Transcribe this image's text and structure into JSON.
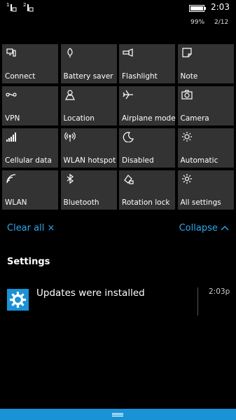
{
  "status_bar": {
    "sim1_index": "1",
    "sim2_index": "2",
    "time": "2:03",
    "battery_percent": "99%",
    "date": "2/12"
  },
  "quick_actions": [
    {
      "label": "Connect",
      "icon": "connect-icon"
    },
    {
      "label": "Battery saver",
      "icon": "battery-saver-icon"
    },
    {
      "label": "Flashlight",
      "icon": "flashlight-icon"
    },
    {
      "label": "Note",
      "icon": "note-icon"
    },
    {
      "label": "VPN",
      "icon": "vpn-icon"
    },
    {
      "label": "Location",
      "icon": "location-icon"
    },
    {
      "label": "Airplane mode",
      "icon": "airplane-icon"
    },
    {
      "label": "Camera",
      "icon": "camera-icon"
    },
    {
      "label": "Cellular data",
      "icon": "cellular-icon"
    },
    {
      "label": "WLAN hotspot",
      "icon": "hotspot-icon"
    },
    {
      "label": "Disabled",
      "icon": "moon-icon"
    },
    {
      "label": "Automatic",
      "icon": "brightness-icon"
    },
    {
      "label": "WLAN",
      "icon": "wlan-icon"
    },
    {
      "label": "Bluetooth",
      "icon": "bluetooth-icon"
    },
    {
      "label": "Rotation lock",
      "icon": "rotation-lock-icon"
    },
    {
      "label": "All settings",
      "icon": "gear-icon"
    }
  ],
  "actions": {
    "clear_all": "Clear all",
    "clear_icon": "×",
    "collapse": "Collapse",
    "collapse_icon": "^"
  },
  "notifications": {
    "section_title": "Settings",
    "items": [
      {
        "title": "Updates were installed",
        "time": "2:03p",
        "icon": "settings-gear-icon"
      }
    ]
  },
  "colors": {
    "accent": "#1a92d6",
    "tile": "#333333",
    "link": "#2aa8f2"
  }
}
